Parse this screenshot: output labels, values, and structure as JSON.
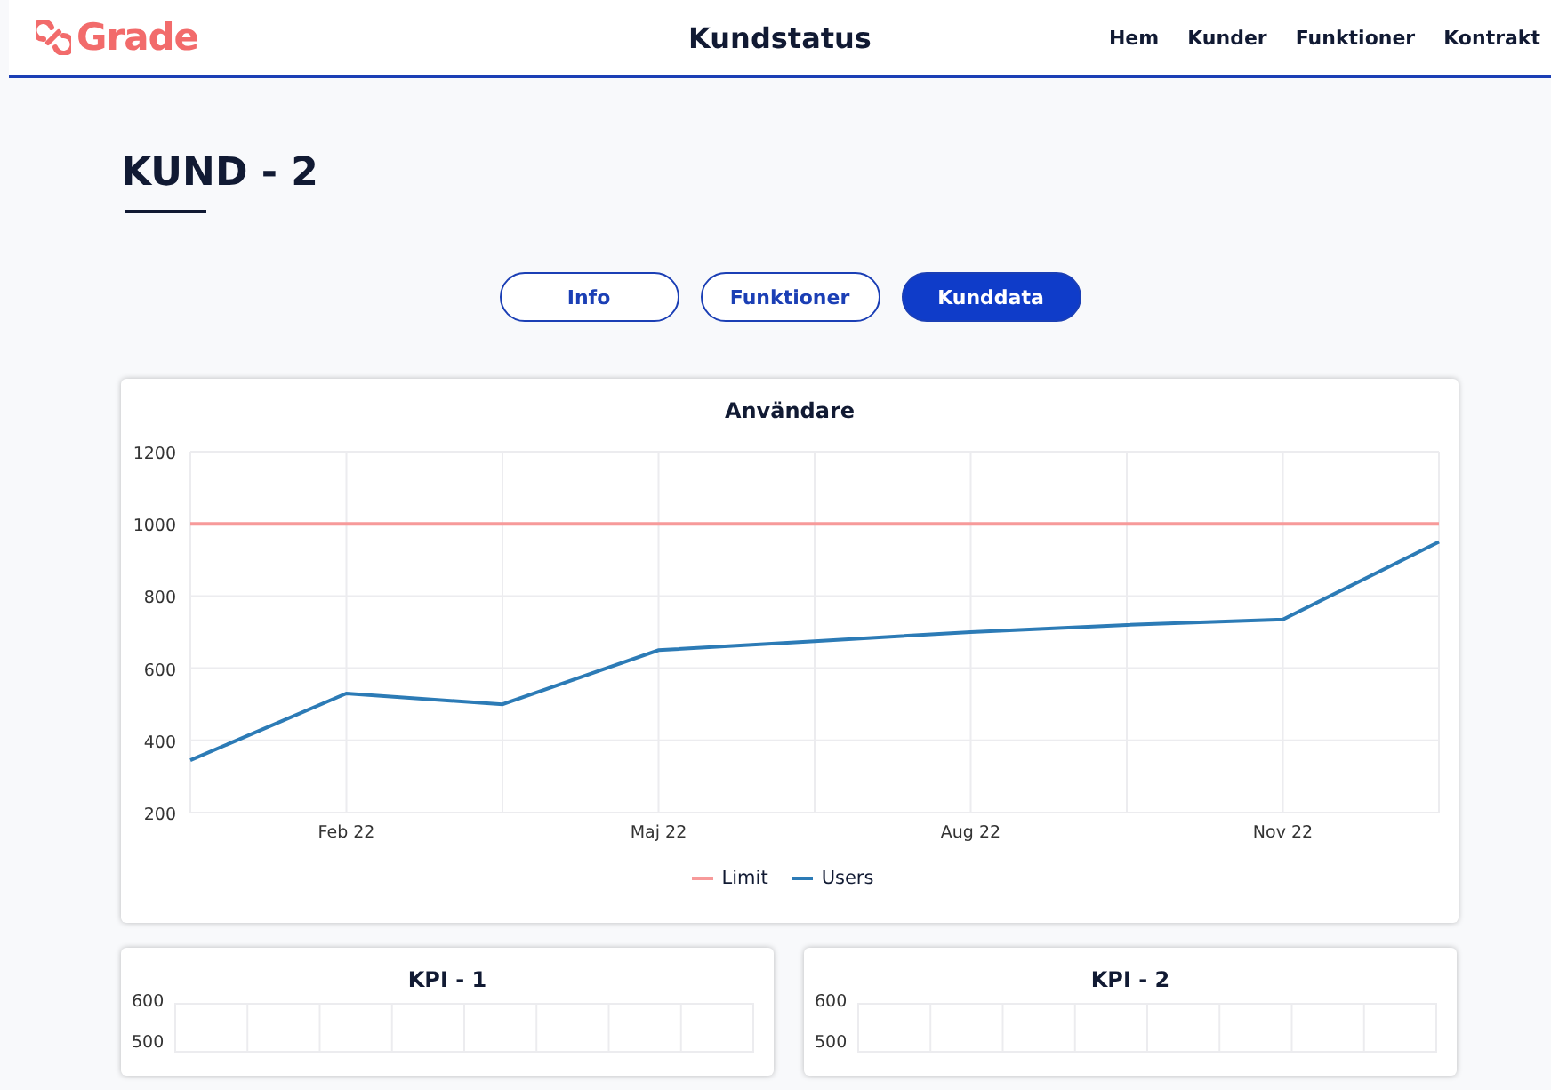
{
  "header": {
    "logo": "Grade",
    "title": "Kundstatus",
    "nav": [
      {
        "label": "Hem"
      },
      {
        "label": "Kunder"
      },
      {
        "label": "Funktioner"
      },
      {
        "label": "Kontrakt"
      }
    ]
  },
  "page": {
    "heading": "KUND - 2"
  },
  "tabs": [
    {
      "label": "Info",
      "selected": false
    },
    {
      "label": "Funktioner",
      "selected": false
    },
    {
      "label": "Kunddata",
      "selected": true
    }
  ],
  "charts": [
    {
      "chart_data": {
        "type": "line",
        "title": "Användare",
        "grid": true,
        "categories": [
          null,
          "Feb 22",
          null,
          "Maj 22",
          null,
          "Aug 22",
          null,
          "Nov 22",
          null
        ],
        "ylim": [
          200,
          1200
        ],
        "yticks": [
          200,
          400,
          600,
          800,
          1000,
          1200
        ],
        "series": [
          {
            "name": "Limit",
            "color": "#f79a9a",
            "values": [
              1000,
              1000,
              1000,
              1000,
              1000,
              1000,
              1000,
              1000,
              1000
            ]
          },
          {
            "name": "Users",
            "color": "#2c7bb6",
            "values": [
              345,
              530,
              500,
              650,
              675,
              700,
              720,
              735,
              950
            ]
          }
        ]
      }
    }
  ],
  "kpis": [
    {
      "title": "KPI - 1",
      "axis_labels": [
        "600",
        "500"
      ]
    },
    {
      "title": "KPI - 2",
      "axis_labels": [
        "600",
        "500"
      ]
    }
  ]
}
